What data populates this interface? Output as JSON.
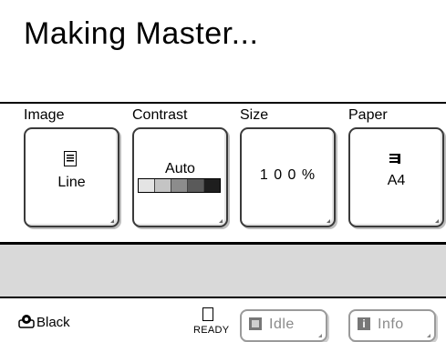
{
  "status": {
    "title": "Making Master..."
  },
  "settings": [
    {
      "label": "Image",
      "value": "Line",
      "icon": "document-icon"
    },
    {
      "label": "Contrast",
      "value": "Auto",
      "icon": "contrast-scale",
      "scale": [
        "#ffffff",
        "#e4e4e4",
        "#c4c4c4",
        "#8c8c8c",
        "#5a5a5a",
        "#1e1e1e"
      ]
    },
    {
      "label": "Size",
      "value": "1 0 0 %"
    },
    {
      "label": "Paper",
      "value": "A4",
      "icon": "paper-tray-icon"
    }
  ],
  "message": "",
  "bottom": {
    "ink_label": "Black",
    "ready_label": "READY",
    "idle_label": "Idle",
    "info_label": "Info",
    "info_glyph": "i"
  }
}
